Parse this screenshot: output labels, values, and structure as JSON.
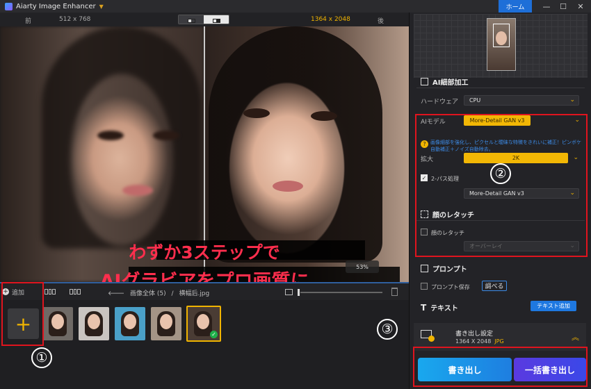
{
  "titlebar": {
    "app_title": "Aiarty Image Enhancer",
    "home_label": "ホーム",
    "minimize_glyph": "—",
    "maximize_glyph": "☐",
    "close_glyph": "✕"
  },
  "compare": {
    "before_label": "前",
    "before_size": "512 x 768",
    "after_size": "1364 x 2048",
    "after_label": "後"
  },
  "overlay": {
    "headline_line1": "わずか3ステップで",
    "headline_line2": "AIグラビアをプロ画質に",
    "zoom": "53%"
  },
  "annotations": {
    "step1": "①",
    "step2": "②",
    "step3": "③"
  },
  "filmstrip": {
    "add_label": "追加",
    "breadcrumb_root": "画像全体 (5)",
    "breadcrumb_sep": "/",
    "breadcrumb_file": "横幅后.jpg",
    "add_tile_glyph": "+",
    "thumb_count": 5,
    "selected_index": 4
  },
  "panel": {
    "section_ai": "AI細部加工",
    "hardware_label": "ハードウェア",
    "hardware_value": "CPU",
    "model_label": "AIモデル",
    "model_value": "More-Detail GAN  v3",
    "model_hint": "画像細部を強化し、ピクセルと曖昧な特徴をきれいに補正！ピンボケ自動補正＋ノイズ自動除去。",
    "scale_label": "拡大",
    "scale_value": "2K",
    "two_pass_label": "2-パス処理",
    "two_pass_checked": true,
    "two_pass_model": "More-Detail GAN  v3",
    "section_face": "顔のレタッチ",
    "face_retouch_label": "顔のレタッチ",
    "face_retouch_checked": false,
    "face_mode": "オーバーレイ",
    "section_prompt": "プロンプト",
    "prompt_save_label": "プロンプト保存",
    "prompt_browse": "調べる",
    "section_text": "テキスト",
    "add_text_button": "テキスト追加",
    "export_settings": "書き出し設定",
    "export_size": "1364 X 2048",
    "export_format": "JPG",
    "export_button": "書き出し",
    "batch_export_button": "一括書き出し"
  },
  "colors": {
    "accent_yellow": "#f2b705",
    "accent_blue": "#1e78e0",
    "annotation_red": "#e0141e",
    "headline_red": "#ff2e4d"
  }
}
